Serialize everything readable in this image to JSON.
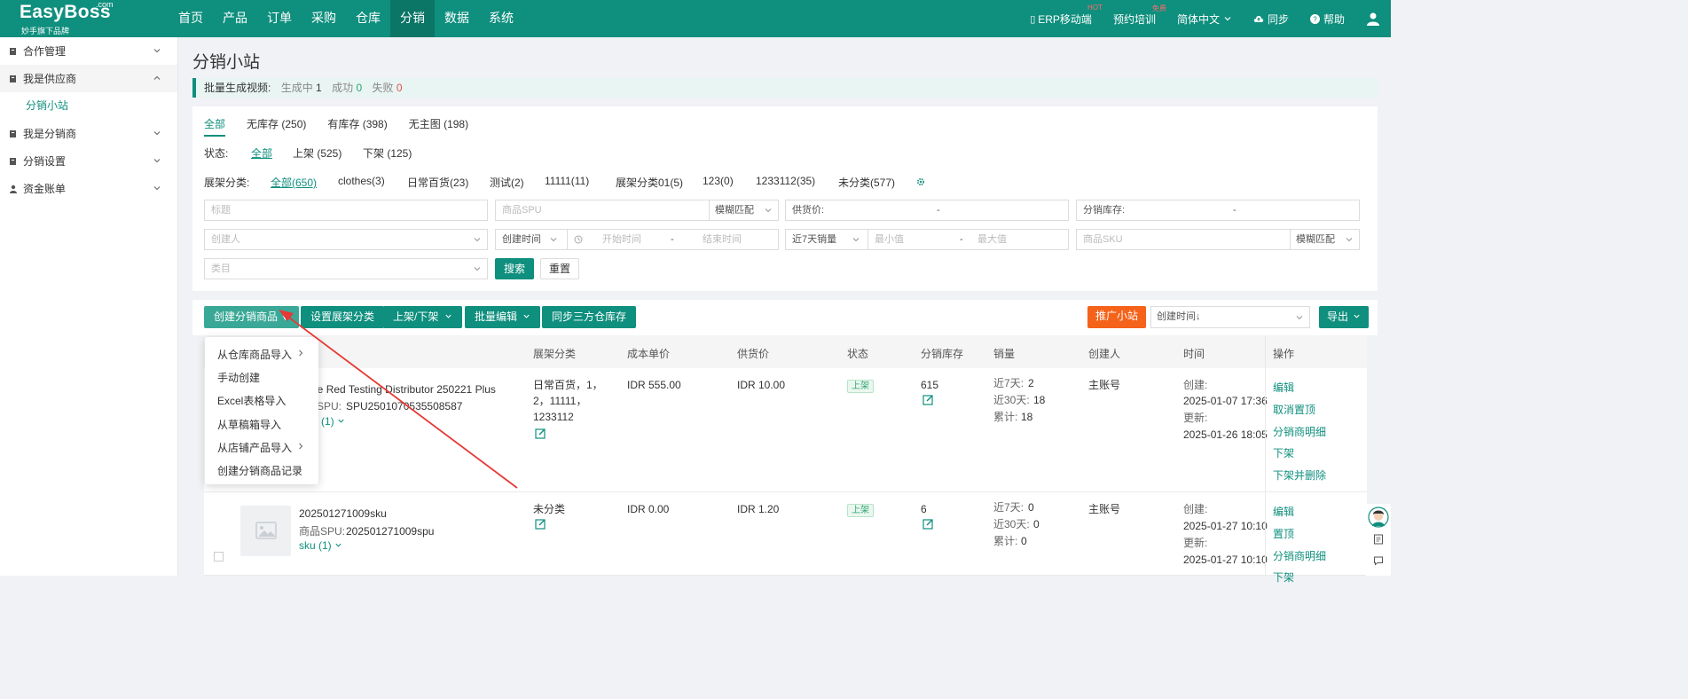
{
  "brand": {
    "name": "EasyBoss",
    "com": ".com",
    "tagline": "妙手旗下品牌"
  },
  "nav": [
    {
      "label": "首页"
    },
    {
      "label": "产品"
    },
    {
      "label": "订单"
    },
    {
      "label": "采购"
    },
    {
      "label": "仓库"
    },
    {
      "label": "分销",
      "active": true
    },
    {
      "label": "数据"
    },
    {
      "label": "系统"
    }
  ],
  "topright": {
    "erp": "ERP移动端",
    "erp_badge": "HOT",
    "training": "预约培训",
    "training_badge": "免费",
    "lang": "简体中文",
    "sync": "同步",
    "help": "帮助"
  },
  "sidebar": {
    "items": [
      {
        "label": "合作管理",
        "icon": "doc-icon"
      },
      {
        "label": "我是供应商",
        "icon": "doc-icon",
        "open": true
      },
      {
        "label": "我是分销商",
        "icon": "doc-icon"
      },
      {
        "label": "分销设置",
        "icon": "doc-icon"
      },
      {
        "label": "资金账单",
        "icon": "user-icon"
      }
    ],
    "subitem": "分销小站"
  },
  "page": {
    "title": "分销小站"
  },
  "notice": {
    "label": "批量生成视频:",
    "generating_label": "生成中",
    "generating": "1",
    "success_label": "成功",
    "success": "0",
    "fail_label": "失败",
    "fail": "0"
  },
  "tabs": [
    {
      "label": "全部",
      "active": true
    },
    {
      "label": "无库存 (250)"
    },
    {
      "label": "有库存 (398)"
    },
    {
      "label": "无主图 (198)"
    }
  ],
  "status_filter": {
    "label": "状态:",
    "options": [
      "全部",
      "上架 (525)",
      "下架 (125)"
    ]
  },
  "shelf_filter": {
    "label": "展架分类:",
    "options": [
      "全部(650)",
      "clothes(3)",
      "日常百货(23)",
      "测试(2)",
      "11111(11)",
      "展架分类01(5)",
      "123(0)",
      "1233112(35)",
      "未分类(577)"
    ]
  },
  "form": {
    "title_ph": "标题",
    "spu_ph": "商品SPU",
    "fuzzy": "模糊匹配",
    "supply_price": "供货价:",
    "dist_stock": "分销库存:",
    "creator_ph": "创建人",
    "create_time": "创建时间",
    "start_time": "开始时间",
    "end_time": "结束时间",
    "sales7": "近7天销量",
    "min": "最小值",
    "max": "最大值",
    "sku_ph": "商品SKU",
    "fuzzy2": "模糊匹配",
    "category_ph": "类目",
    "search_btn": "搜索",
    "reset_btn": "重置",
    "dash": "-"
  },
  "toolbar": {
    "create": "创建分销商品",
    "set_shelf": "设置展架分类",
    "onoff": "上架/下架",
    "batch_edit": "批量编辑",
    "sync_stock": "同步三方仓库存",
    "promote": "推广小站",
    "sort": "创建时间↓",
    "export": "导出"
  },
  "dropdown": [
    {
      "label": "从仓库商品导入",
      "sub": true
    },
    {
      "label": "手动创建"
    },
    {
      "label": "Excel表格导入"
    },
    {
      "label": "从草稿箱导入"
    },
    {
      "label": "从店铺产品导入",
      "sub": true
    },
    {
      "label": "创建分销商品记录"
    }
  ],
  "table": {
    "headers": [
      "展架分类",
      "成本单价",
      "供货价",
      "状态",
      "分销库存",
      "销量",
      "创建人",
      "时间",
      "操作"
    ],
    "rows": [
      {
        "title": "nate Red Testing Distributor 250221 Plus",
        "spu_label": "SPU:",
        "spu": "SPU250107053550858​7",
        "sku": "(1)",
        "shelf_lines": [
          "日常百货，1，",
          "2，11111，",
          "1233112"
        ],
        "cost": "IDR 555.00",
        "price": "IDR 10.00",
        "status": "上架",
        "stock": "615",
        "sales_7_label": "近7天:",
        "sales_7": "2",
        "sales_30_label": "近30天:",
        "sales_30": "18",
        "sales_total_label": "累计:",
        "sales_total": "18",
        "creator": "主账号",
        "created_label": "创建:",
        "created": "2025-01-07 17:36",
        "updated_label": "更新:",
        "updated": "2025-01-26 18:05",
        "ops": [
          "编辑",
          "取消置顶",
          "分销商明细",
          "下架",
          "下架并删除"
        ]
      },
      {
        "title": "202501271009sku",
        "spu_label": "商品SPU:",
        "spu": "202501271009spu",
        "sku": "sku (1)",
        "shelf_lines": [
          "未分类"
        ],
        "cost": "IDR 0.00",
        "price": "IDR 1.20",
        "status": "上架",
        "stock": "6",
        "sales_7_label": "近7天:",
        "sales_7": "0",
        "sales_30_label": "近30天:",
        "sales_30": "0",
        "sales_total_label": "累计:",
        "sales_total": "0",
        "creator": "主账号",
        "created_label": "创建:",
        "created": "2025-01-27 10:10",
        "updated_label": "更新:",
        "updated": "2025-01-27 10:10",
        "ops": [
          "编辑",
          "置顶",
          "分销商明细",
          "下架"
        ]
      }
    ]
  },
  "colors": {
    "primary": "#0f8f7e",
    "orange": "#f5621a",
    "annotation_arrow": "#e53935"
  }
}
